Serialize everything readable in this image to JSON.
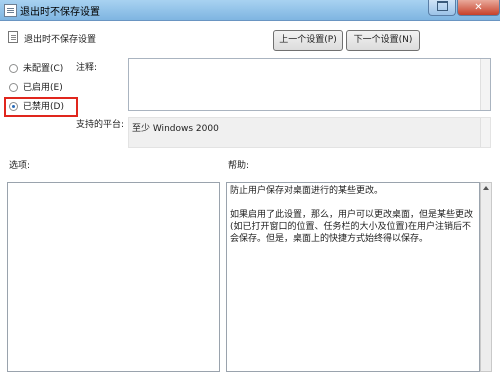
{
  "window": {
    "title": "退出时不保存设置",
    "maximize_glyph": "",
    "close_glyph": "✕"
  },
  "header": {
    "setting_name": "退出时不保存设置",
    "prev_button": "上一个设置(P)",
    "next_button": "下一个设置(N)"
  },
  "state": {
    "options": [
      {
        "label": "未配置(C)",
        "selected": false
      },
      {
        "label": "已启用(E)",
        "selected": false
      },
      {
        "label": "已禁用(D)",
        "selected": true
      }
    ]
  },
  "comment": {
    "label": "注释:",
    "value": ""
  },
  "platform": {
    "label": "支持的平台:",
    "value": "至少 Windows 2000"
  },
  "options_panel": {
    "label": "选项:"
  },
  "help": {
    "label": "帮助:",
    "paragraphs": [
      "防止用户保存对桌面进行的某些更改。",
      "如果启用了此设置，那么，用户可以更改桌面，但是某些更改(如已打开窗口的位置、任务栏的大小及位置)在用户注销后不会保存。但是，桌面上的快捷方式始终得以保存。"
    ]
  },
  "colors": {
    "highlight_box": "#e0261d",
    "title_bar": "#a8d2f1"
  }
}
